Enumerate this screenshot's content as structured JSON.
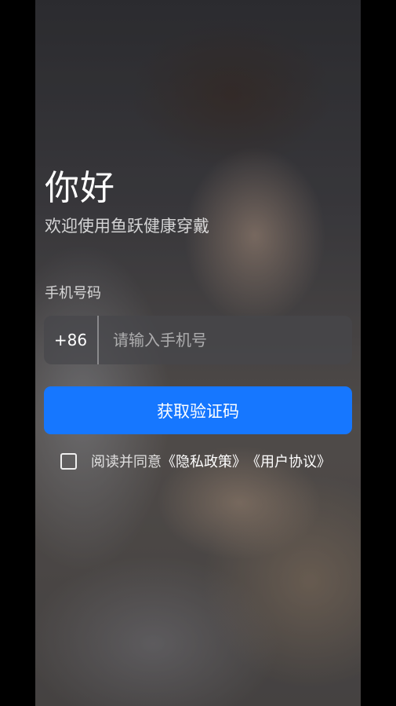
{
  "greeting": "你好",
  "welcome": "欢迎使用鱼跃健康穿戴",
  "phone": {
    "label": "手机号码",
    "country_code": "+86",
    "placeholder": "请输入手机号",
    "value": ""
  },
  "get_code_button": "获取验证码",
  "agreement": {
    "prefix": "阅读并同意",
    "privacy_link": "《隐私政策》",
    "terms_link": "《用户协议》",
    "checked": false
  },
  "colors": {
    "accent": "#1677ff"
  }
}
